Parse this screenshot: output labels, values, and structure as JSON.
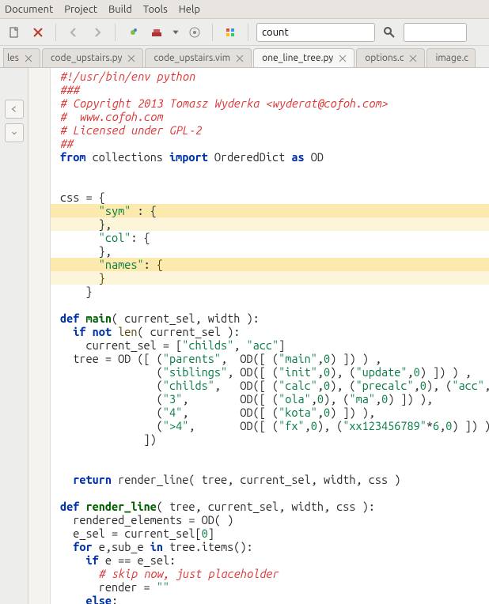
{
  "menu": {
    "items": [
      "Document",
      "Project",
      "Build",
      "Tools",
      "Help"
    ]
  },
  "toolbar": {
    "search_value": "count",
    "goto_value": ""
  },
  "tabs": {
    "side": "les",
    "items": [
      {
        "label": "code_upstairs.py",
        "active": false
      },
      {
        "label": "code_upstairs.vim",
        "active": false
      },
      {
        "label": "one_line_tree.py",
        "active": true
      },
      {
        "label": "options.c",
        "active": false
      },
      {
        "label": "image.c",
        "active": false
      }
    ]
  },
  "code": {
    "shebang": "#!/usr/bin/env python",
    "hdr1": "###",
    "hdr2": "# Copyright 2013 Tomasz Wyderka <wyderat@cofoh.com>",
    "hdr3": "#  www.cofoh.com",
    "hdr4": "# Licensed under GPL-2",
    "hdr5": "##",
    "imp1": "from",
    "imp2": "collections",
    "imp3": "import",
    "imp4": "OrderedDict",
    "imp5": "as",
    "imp6": "OD",
    "css_l1a": "css",
    "css_l2k": "\"sym\"",
    "css_l3k": "\"col\"",
    "css_l4k": "\"names\"",
    "main_def": "def",
    "main_name": "main",
    "main_args": "( current_sel, width ):",
    "main_if": "if not",
    "main_len": "len",
    "main_len_arg": "( current_sel ):",
    "main_cs": "    current_sel = [",
    "main_cs_s1": "\"childs\"",
    "main_cs_s2": "\"acc\"",
    "tree_assign": "  tree = OD ([ (",
    "t_parents": "\"parents\"",
    "t_main": "\"main\"",
    "t_siblings": "\"siblings\"",
    "t_init": "\"init\"",
    "t_update": "\"update\"",
    "t_childs": "\"childs\"",
    "t_calc": "\"calc\"",
    "t_precalc": "\"precalc\"",
    "t_acc": "\"acc\"",
    "t_3": "\"3\"",
    "t_ola": "\"ola\"",
    "t_ma": "\"ma\"",
    "t_4": "\"4\"",
    "t_kota": "\"kota\"",
    "t_g4": "\">4\"",
    "t_fx": "\"fx\"",
    "t_xx": "\"xx123456789\"",
    "ret": "return",
    "ret_call": "render_line( tree, current_sel, width, css )",
    "rl_name": "render_line",
    "rl_args": "( tree, current_sel, width, css ):",
    "rl_l1": "  rendered_elements = OD( )",
    "rl_l2": "  e_sel = current_sel[",
    "rl_for": "for",
    "rl_for2": "e,sub_e",
    "rl_in": "in",
    "rl_for3": "tree.items():",
    "rl_if": "if",
    "rl_ifc": "e == e_sel:",
    "rl_cmt": "# skip now, just placeholder",
    "rl_r": "      render = ",
    "rl_rs": "\"\"",
    "rl_else": "else",
    "zero": "0",
    "six": "6"
  }
}
